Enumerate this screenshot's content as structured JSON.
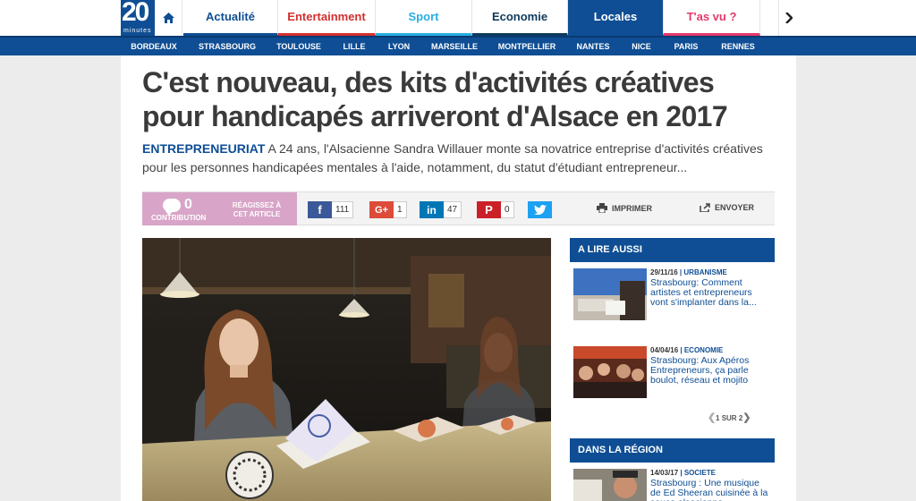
{
  "logo": {
    "number": "20",
    "word": "minutes"
  },
  "nav": {
    "tabs": [
      "Actualité",
      "Entertainment",
      "Sport",
      "Economie",
      "Locales",
      "T'as vu ?"
    ]
  },
  "cities": [
    "BORDEAUX",
    "STRASBOURG",
    "TOULOUSE",
    "LILLE",
    "LYON",
    "MARSEILLE",
    "MONTPELLIER",
    "NANTES",
    "NICE",
    "PARIS",
    "RENNES"
  ],
  "article": {
    "title": "C'est nouveau, des kits d'activités créatives pour handicapés arriveront d'Alsace en 2017",
    "kicker": "ENTREPRENEURIAT",
    "lead": "A 24 ans, l'Alsacienne Sandra Willauer monte sa novatrice entreprise d'activités créatives pour les personnes handicapées mentales à l'aide, notamment, du statut d'étudiant entrepreneur..."
  },
  "share": {
    "contributions": "0",
    "contribution_label": "CONTRIBUTION",
    "react_label": "RÉAGISSEZ À CET ARTICLE",
    "facebook_count": "111",
    "googleplus_count": "1",
    "linkedin_count": "47",
    "pinterest_count": "0",
    "print_label": "IMPRIMER",
    "email_label": "ENVOYER"
  },
  "sidebar": {
    "read_also": {
      "heading": "A LIRE AUSSI",
      "items": [
        {
          "date": "29/11/16",
          "category": "URBANISME",
          "text": "Strasbourg: Comment artistes et entrepreneurs vont s'implanter dans la..."
        },
        {
          "date": "04/04/16",
          "category": "ECONOMIE",
          "text": "Strasbourg: Aux Apéros Entrepreneurs, ça parle boulot, réseau et mojito"
        }
      ],
      "pager": {
        "current": "1",
        "sep": "SUR",
        "total": "2"
      }
    },
    "region": {
      "heading": "DANS LA RÉGION",
      "items": [
        {
          "date": "14/03/17",
          "category": "SOCIETE",
          "text": "Strasbourg : Une musique de Ed Sheeran cuisinée à la sauce alsacienne"
        }
      ]
    }
  },
  "colors": {
    "brand": "#0f4e94",
    "entertainment": "#d32f2f",
    "sport": "#29aee0",
    "tasvu": "#e4386b",
    "contrib": "#d8a5c8"
  }
}
